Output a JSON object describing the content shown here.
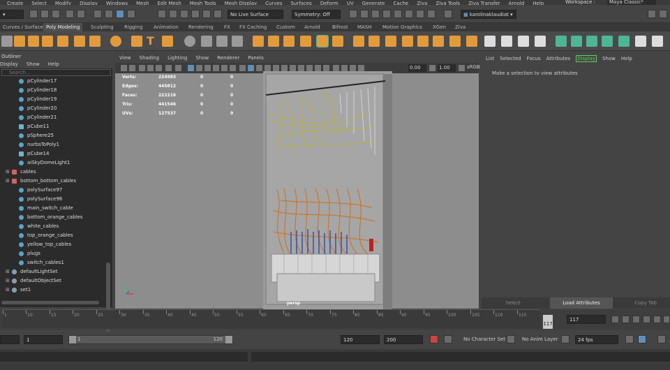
{
  "menubar": {
    "items": [
      "Create",
      "Select",
      "Modify",
      "Display",
      "Windows",
      "Mesh",
      "Edit Mesh",
      "Mesh Tools",
      "Mesh Display",
      "Curves",
      "Surfaces",
      "Deform",
      "UV",
      "Generate",
      "Cache",
      "Ziva",
      "Ziva Tools",
      "Ziva Transfer",
      "Arnold",
      "Help"
    ],
    "workspace_label": "Workspace :",
    "workspace_value": "Maya Classic*"
  },
  "statusline": {
    "no_live_surface": "No Live Surface",
    "symmetry": "Symmetry: Off",
    "user": "karolinaklaudiat"
  },
  "shelf_tabs": [
    "Curves / Surfaces",
    "Poly Modeling",
    "Sculpting",
    "Rigging",
    "Animation",
    "Rendering",
    "FX",
    "FX Caching",
    "Custom",
    "Arnold",
    "Bifrost",
    "MASH",
    "Motion Graphics",
    "XGen",
    "Ziva"
  ],
  "shelf_active": "Poly Modeling",
  "outliner": {
    "title": "Outliner",
    "menus": [
      "Display",
      "Show",
      "Help"
    ],
    "search_placeholder": "Search...",
    "items": [
      {
        "name": "pCylinder17",
        "type": "mesh"
      },
      {
        "name": "pCylinder18",
        "type": "mesh"
      },
      {
        "name": "pCylinder19",
        "type": "mesh"
      },
      {
        "name": "pCylinder20",
        "type": "mesh"
      },
      {
        "name": "pCylinder21",
        "type": "mesh"
      },
      {
        "name": "pCube11",
        "type": "cube"
      },
      {
        "name": "pSphere25",
        "type": "mesh"
      },
      {
        "name": "nurbsToPoly1",
        "type": "mesh"
      },
      {
        "name": "pCube14",
        "type": "cube"
      },
      {
        "name": "aiSkyDomeLight1",
        "type": "light"
      },
      {
        "name": "cables",
        "type": "group"
      },
      {
        "name": "bottom_bottom_cables",
        "type": "group"
      },
      {
        "name": "polySurface97",
        "type": "mesh"
      },
      {
        "name": "polySurface96",
        "type": "mesh"
      },
      {
        "name": "main_switch_cable",
        "type": "mesh"
      },
      {
        "name": "bottom_orange_cables",
        "type": "mesh"
      },
      {
        "name": "white_cables",
        "type": "mesh"
      },
      {
        "name": "top_orange_cables",
        "type": "mesh"
      },
      {
        "name": "yellow_top_cables",
        "type": "mesh"
      },
      {
        "name": "plugs",
        "type": "mesh"
      },
      {
        "name": "switch_cables1",
        "type": "mesh"
      },
      {
        "name": "defaultLightSet",
        "type": "set"
      },
      {
        "name": "defaultObjectSet",
        "type": "set"
      },
      {
        "name": "set1",
        "type": "set"
      }
    ]
  },
  "viewport": {
    "menus": [
      "View",
      "Shading",
      "Lighting",
      "Show",
      "Renderer",
      "Panels"
    ],
    "field1": "0.00",
    "field2": "1.00",
    "color_space": "sRGB",
    "camera": "persp",
    "hud": [
      {
        "label": "Verts:",
        "v1": "224983",
        "v2": "0",
        "v3": "0"
      },
      {
        "label": "Edges:",
        "v1": "445812",
        "v2": "0",
        "v3": "0"
      },
      {
        "label": "Faces:",
        "v1": "222216",
        "v2": "0",
        "v3": "0"
      },
      {
        "label": "Tris:",
        "v1": "441546",
        "v2": "0",
        "v3": "0"
      },
      {
        "label": "UVs:",
        "v1": "127537",
        "v2": "0",
        "v3": "0"
      }
    ]
  },
  "attribute_editor": {
    "menus": [
      "List",
      "Selected",
      "Focus",
      "Attributes",
      "Display",
      "Show",
      "Help"
    ],
    "message": "Make a selection to view attributes",
    "buttons": [
      "Select",
      "Load Attributes",
      "Copy Tab"
    ]
  },
  "timeslider": {
    "ticks": [
      "1",
      "10",
      "15",
      "20",
      "25",
      "30",
      "35",
      "40",
      "45",
      "50",
      "55",
      "60",
      "65",
      "70",
      "75",
      "80",
      "85",
      "90",
      "95",
      "100",
      "105",
      "110",
      "115"
    ],
    "current_frame": "117",
    "current_field": "117"
  },
  "range": {
    "start": "1",
    "range_start": "1",
    "range_end": "120",
    "end": "120",
    "anim_end": "200",
    "character_set": "No Character Set",
    "anim_layer": "No Anim Layer",
    "fps": "24 fps"
  },
  "colors": {
    "accent_orange": "#e39a3b",
    "accent_teal": "#4db694",
    "display_green": "#5ecf5e"
  }
}
